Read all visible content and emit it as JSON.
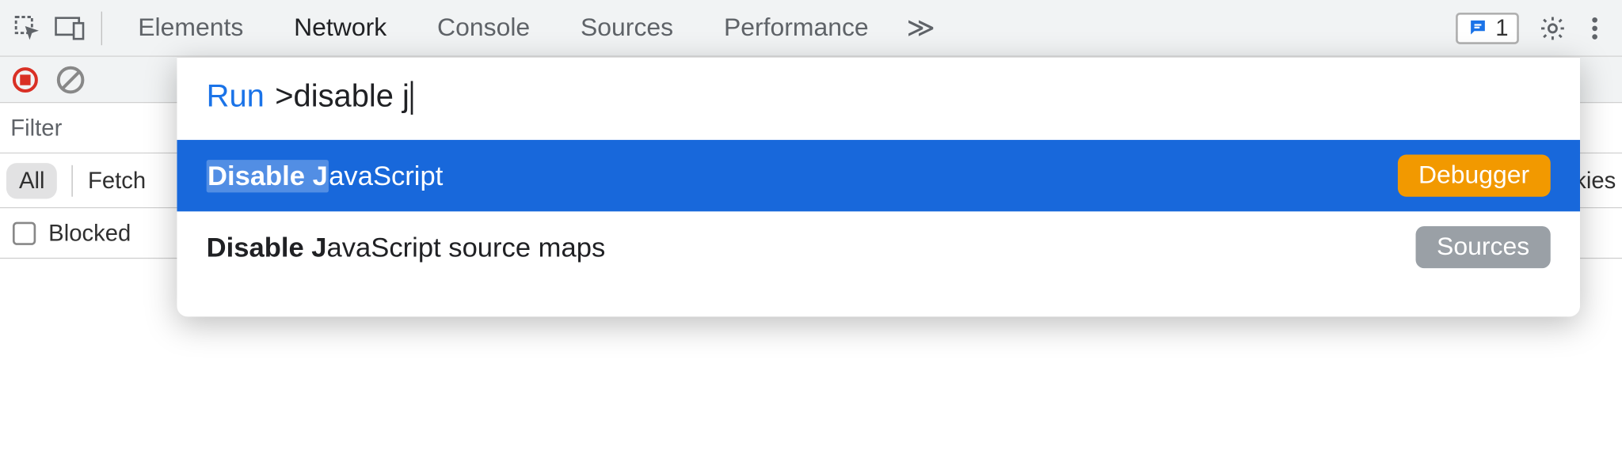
{
  "tabs": {
    "elements": "Elements",
    "network": "Network",
    "console": "Console",
    "sources": "Sources",
    "performance": "Performance",
    "more": "≫"
  },
  "issues": {
    "count": "1"
  },
  "filter": {
    "placeholder": "Filter"
  },
  "types": {
    "all": "All",
    "fetch": "Fetch",
    "cookies_tail": "ookies"
  },
  "blocked": {
    "label": "Blocked"
  },
  "palette": {
    "run_label": "Run",
    "prefix": ">",
    "query": "disable j",
    "items": [
      {
        "match": "Disable J",
        "rest": "avaScript",
        "badge": "Debugger",
        "badge_color": "orange",
        "selected": true
      },
      {
        "match": "Disable J",
        "rest": "avaScript source maps",
        "badge": "Sources",
        "badge_color": "gray",
        "selected": false
      }
    ]
  }
}
